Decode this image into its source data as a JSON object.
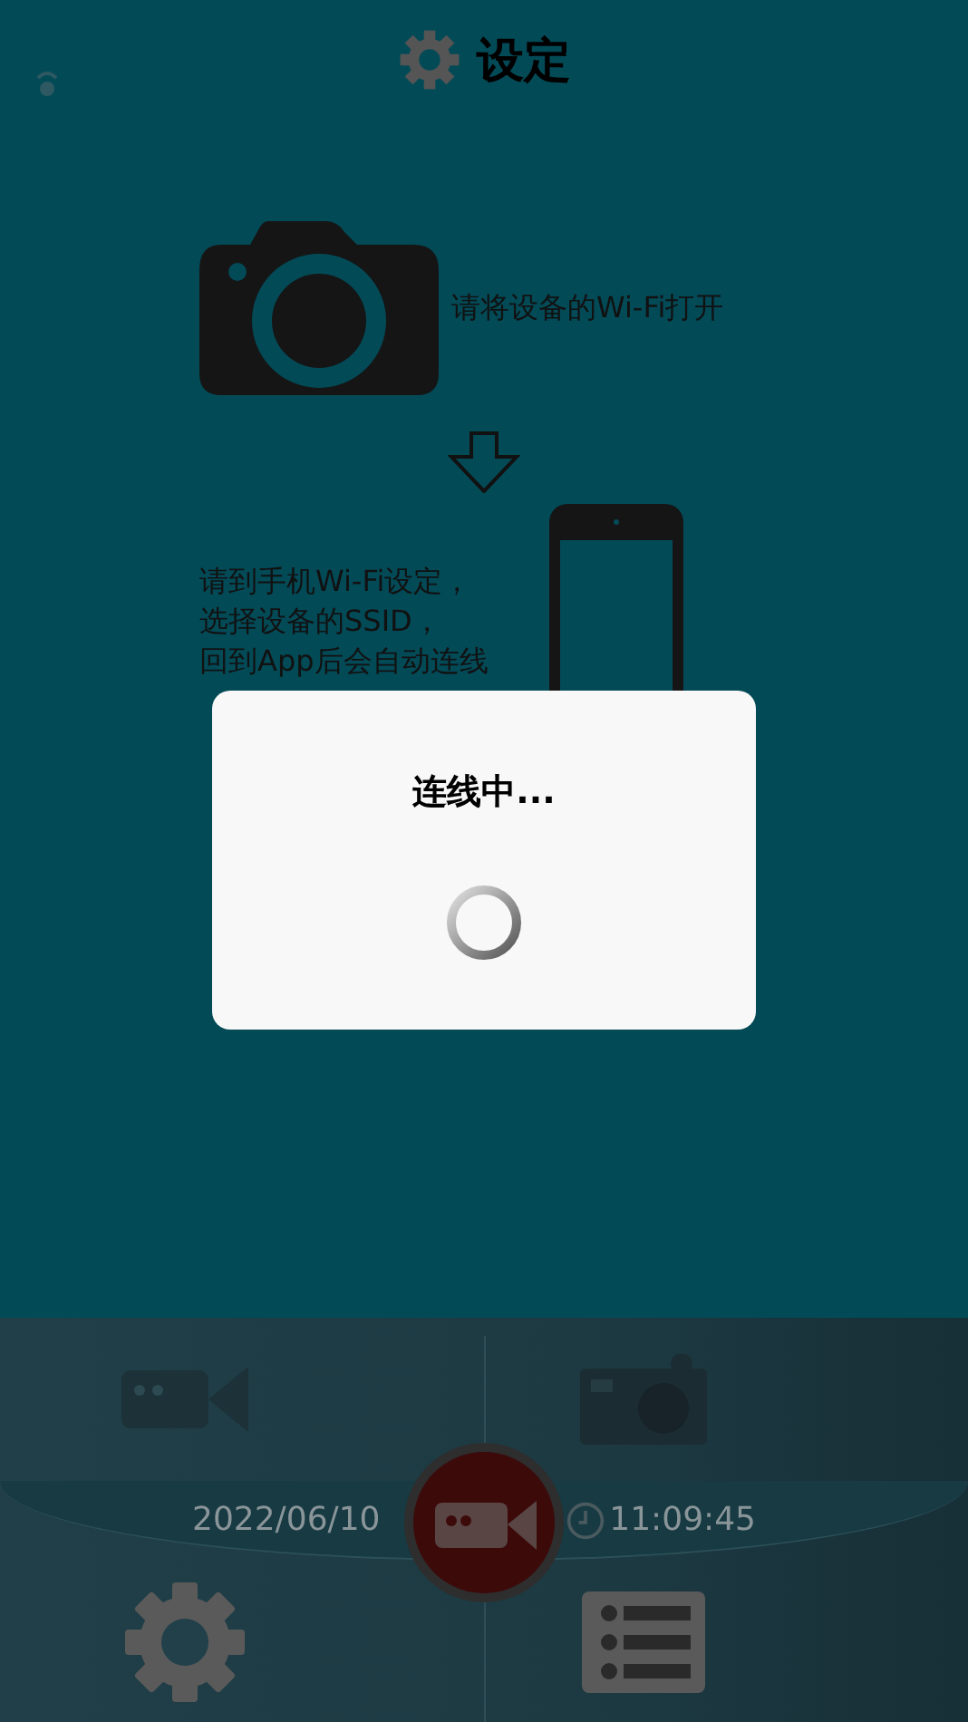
{
  "header": {
    "title": "设定"
  },
  "instructions": [
    {
      "text": "请将设备的Wi-Fi打开"
    },
    {
      "lines": [
        "请到手机Wi-Fi设定，",
        "选择设备的SSID，",
        "回到App后会自动连线"
      ]
    }
  ],
  "dialog": {
    "message": "连线中..."
  },
  "control_panel": {
    "date": "2022/06/10",
    "time": "11:09:45"
  }
}
